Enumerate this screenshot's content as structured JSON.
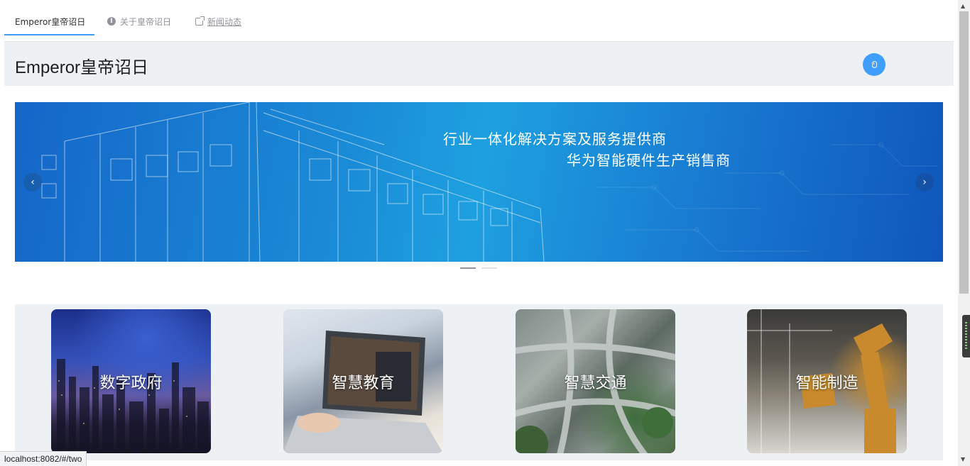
{
  "tabs": [
    {
      "label": "Emperor皇帝诏日",
      "icon": "",
      "active": true
    },
    {
      "label": "关于皇帝诏日",
      "icon": "info-icon",
      "active": false
    },
    {
      "label": "新闻动态",
      "icon": "external-link-icon",
      "active": false
    }
  ],
  "header": {
    "title": "Emperor皇帝诏日",
    "action_icon": "mouse-icon"
  },
  "banner": {
    "line1": "行业一体化解决方案及服务提供商",
    "line2": "华为智能硬件生产销售商",
    "prev_icon": "chevron-left-icon",
    "next_icon": "chevron-right-icon",
    "prev_glyph": "‹",
    "next_glyph": "›",
    "indicator_count": 2,
    "active_indicator": 0
  },
  "solutions": [
    {
      "label": "数字政府"
    },
    {
      "label": "智慧教育"
    },
    {
      "label": "智慧交通"
    },
    {
      "label": "智能制造"
    }
  ],
  "status_bar": {
    "url": "localhost:8082/#/two"
  },
  "colors": {
    "accent": "#409eff",
    "header_bg": "#eef1f3",
    "banner_blue": "#1a8ad6"
  }
}
